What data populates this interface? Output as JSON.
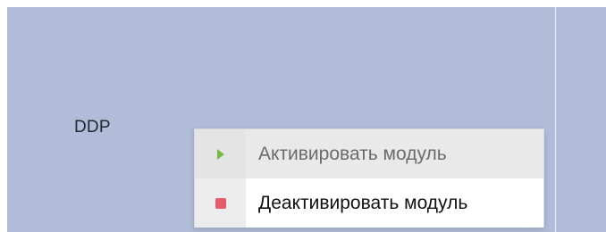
{
  "module": {
    "name": "DDP"
  },
  "context_menu": {
    "items": [
      {
        "label": "Активировать модуль",
        "icon": "play-icon",
        "icon_color": "#7ab648",
        "state": "hovered"
      },
      {
        "label": "Деактивировать модуль",
        "icon": "stop-icon",
        "icon_color": "#e45b6a",
        "state": "normal"
      }
    ]
  },
  "colors": {
    "panel_background": "#b0bcd8",
    "menu_hover_background": "#e9e9e9",
    "menu_background": "#ffffff"
  }
}
